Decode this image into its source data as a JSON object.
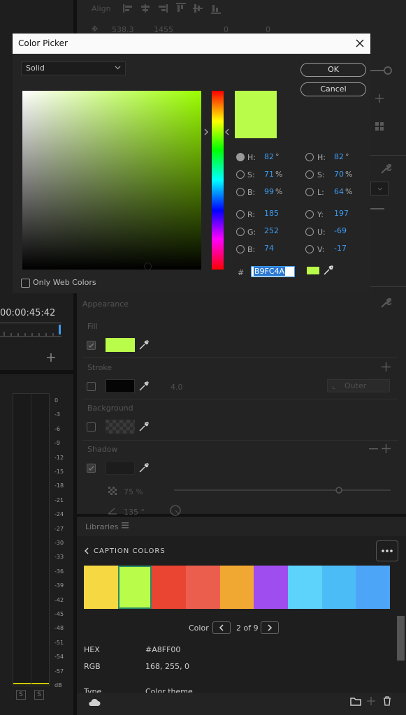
{
  "background": {
    "align_label": "Align",
    "coord_x": "538.3",
    "coord_y": "1455",
    "coord_a": "0",
    "coord_b": "0",
    "timecode": "00:00:45:42",
    "appearance_label": "Appearance",
    "fill_label": "Fill",
    "stroke_label": "Stroke",
    "stroke_width": "4.0",
    "stroke_position": "Outer",
    "background_label": "Background",
    "shadow_label": "Shadow",
    "shadow_opacity": "75 %",
    "shadow_angle": "135 °",
    "fill_color": "#B9FC4A"
  },
  "meter": {
    "ticks": [
      "0",
      "-3",
      "-6",
      "-9",
      "-12",
      "-15",
      "-18",
      "-21",
      "-24",
      "-27",
      "-30",
      "-33",
      "-36",
      "-39",
      "-42",
      "-45",
      "-48",
      "-51",
      "-54",
      "-57",
      "dB"
    ],
    "solo_left": "S",
    "solo_right": "S"
  },
  "dialog": {
    "title": "Color Picker",
    "fill_type": "Solid",
    "ok_label": "OK",
    "cancel_label": "Cancel",
    "only_web_colors": "Only Web Colors",
    "hash": "#",
    "hex_value": "B9FC4A",
    "selected_color": "#B9FC4A",
    "hsb": [
      {
        "label": "H:",
        "value": "82",
        "unit": "°"
      },
      {
        "label": "S:",
        "value": "71",
        "unit": "%"
      },
      {
        "label": "B:",
        "value": "99",
        "unit": "%"
      }
    ],
    "rgb": [
      {
        "label": "R:",
        "value": "185"
      },
      {
        "label": "G:",
        "value": "252"
      },
      {
        "label": "B:",
        "value": "74"
      }
    ],
    "hsl": [
      {
        "label": "H:",
        "value": "82",
        "unit": "°"
      },
      {
        "label": "S:",
        "value": "70",
        "unit": "%"
      },
      {
        "label": "L:",
        "value": "64",
        "unit": "%"
      }
    ],
    "yuv": [
      {
        "label": "Y:",
        "value": "197"
      },
      {
        "label": "U:",
        "value": "-69"
      },
      {
        "label": "V:",
        "value": "-17"
      }
    ]
  },
  "libraries": {
    "header": "Libraries",
    "collection_title": "CAPTION COLORS",
    "swatch_colors": [
      "#F6D843",
      "#B9FC4A",
      "#EA4432",
      "#EB5E4E",
      "#F1A833",
      "#A04DF0",
      "#5DD2FB",
      "#4CBCF6",
      "#4DA5F7"
    ],
    "pager_label": "Color",
    "pager_value": "2 of 9",
    "hex_label": "HEX",
    "hex_value": "#A8FF00",
    "rgb_label": "RGB",
    "rgb_value": "168, 255, 0",
    "type_label": "Type",
    "type_value": "Color theme"
  }
}
